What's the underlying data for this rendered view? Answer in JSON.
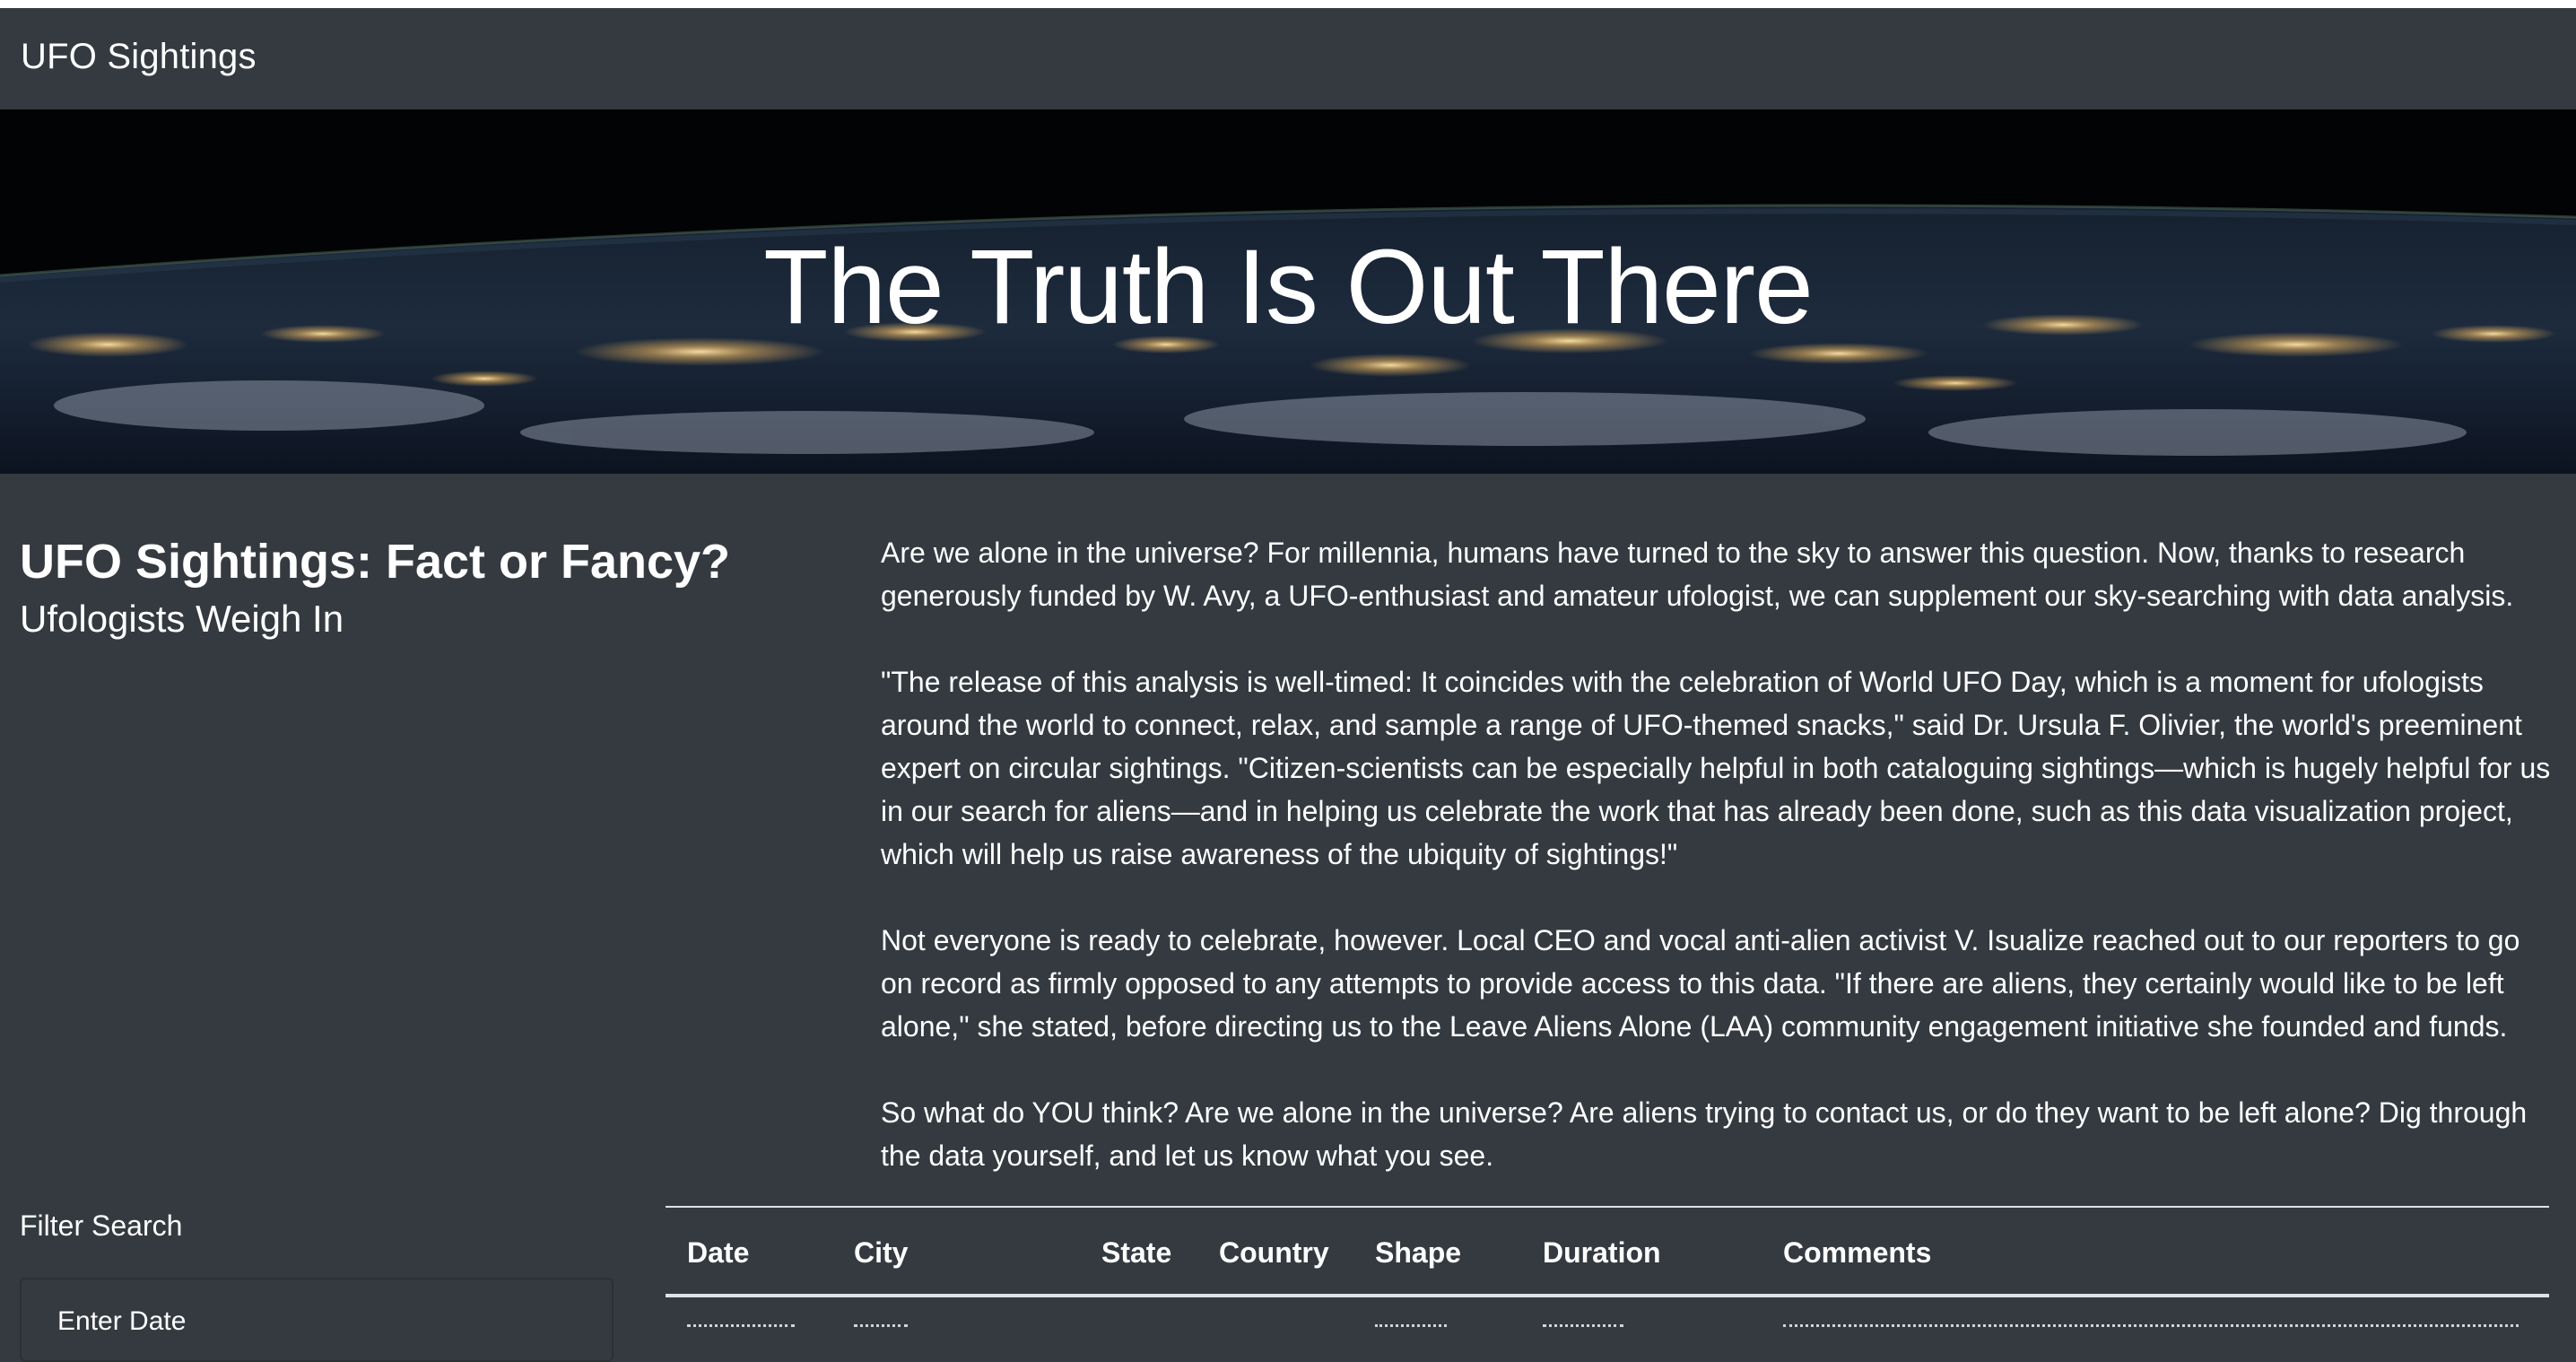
{
  "navbar": {
    "brand": "UFO Sightings"
  },
  "hero": {
    "title": "The Truth Is Out There"
  },
  "intro": {
    "heading": "UFO Sightings: Fact or Fancy?",
    "subheading": "Ufologists Weigh In"
  },
  "article": {
    "paragraphs": [
      "Are we alone in the universe? For millennia, humans have turned to the sky to answer this question. Now, thanks to research generously funded by W. Avy, a UFO-enthusiast and amateur ufologist, we can supplement our sky-searching with data analysis.",
      "\"The release of this analysis is well-timed: It coincides with the celebration of World UFO Day, which is a moment for ufologists around the world to connect, relax, and sample a range of UFO-themed snacks,\" said Dr. Ursula F. Olivier, the world's preeminent expert on circular sightings. \"Citizen-scientists can be especially helpful in both cataloguing sightings—which is hugely helpful for us in our search for aliens—and in helping us celebrate the work that has already been done, such as this data visualization project, which will help us raise awareness of the ubiquity of sightings!\"",
      "Not everyone is ready to celebrate, however. Local CEO and vocal anti-alien activist V. Isualize reached out to our reporters to go on record as firmly opposed to any attempts to provide access to this data. \"If there are aliens, they certainly would like to be left alone,\" she stated, before directing us to the Leave Aliens Alone (LAA) community engagement initiative she founded and funds.",
      "So what do YOU think? Are we alone in the universe? Are aliens trying to contact us, or do they want to be left alone? Dig through the data yourself, and let us know what you see."
    ]
  },
  "filters": {
    "title": "Filter Search",
    "date_label": "Enter Date"
  },
  "table": {
    "columns": [
      "Date",
      "City",
      "State",
      "Country",
      "Shape",
      "Duration",
      "Comments"
    ]
  },
  "colors": {
    "background": "#343a40",
    "text": "#ffffff",
    "rule": "#dee2e6"
  }
}
